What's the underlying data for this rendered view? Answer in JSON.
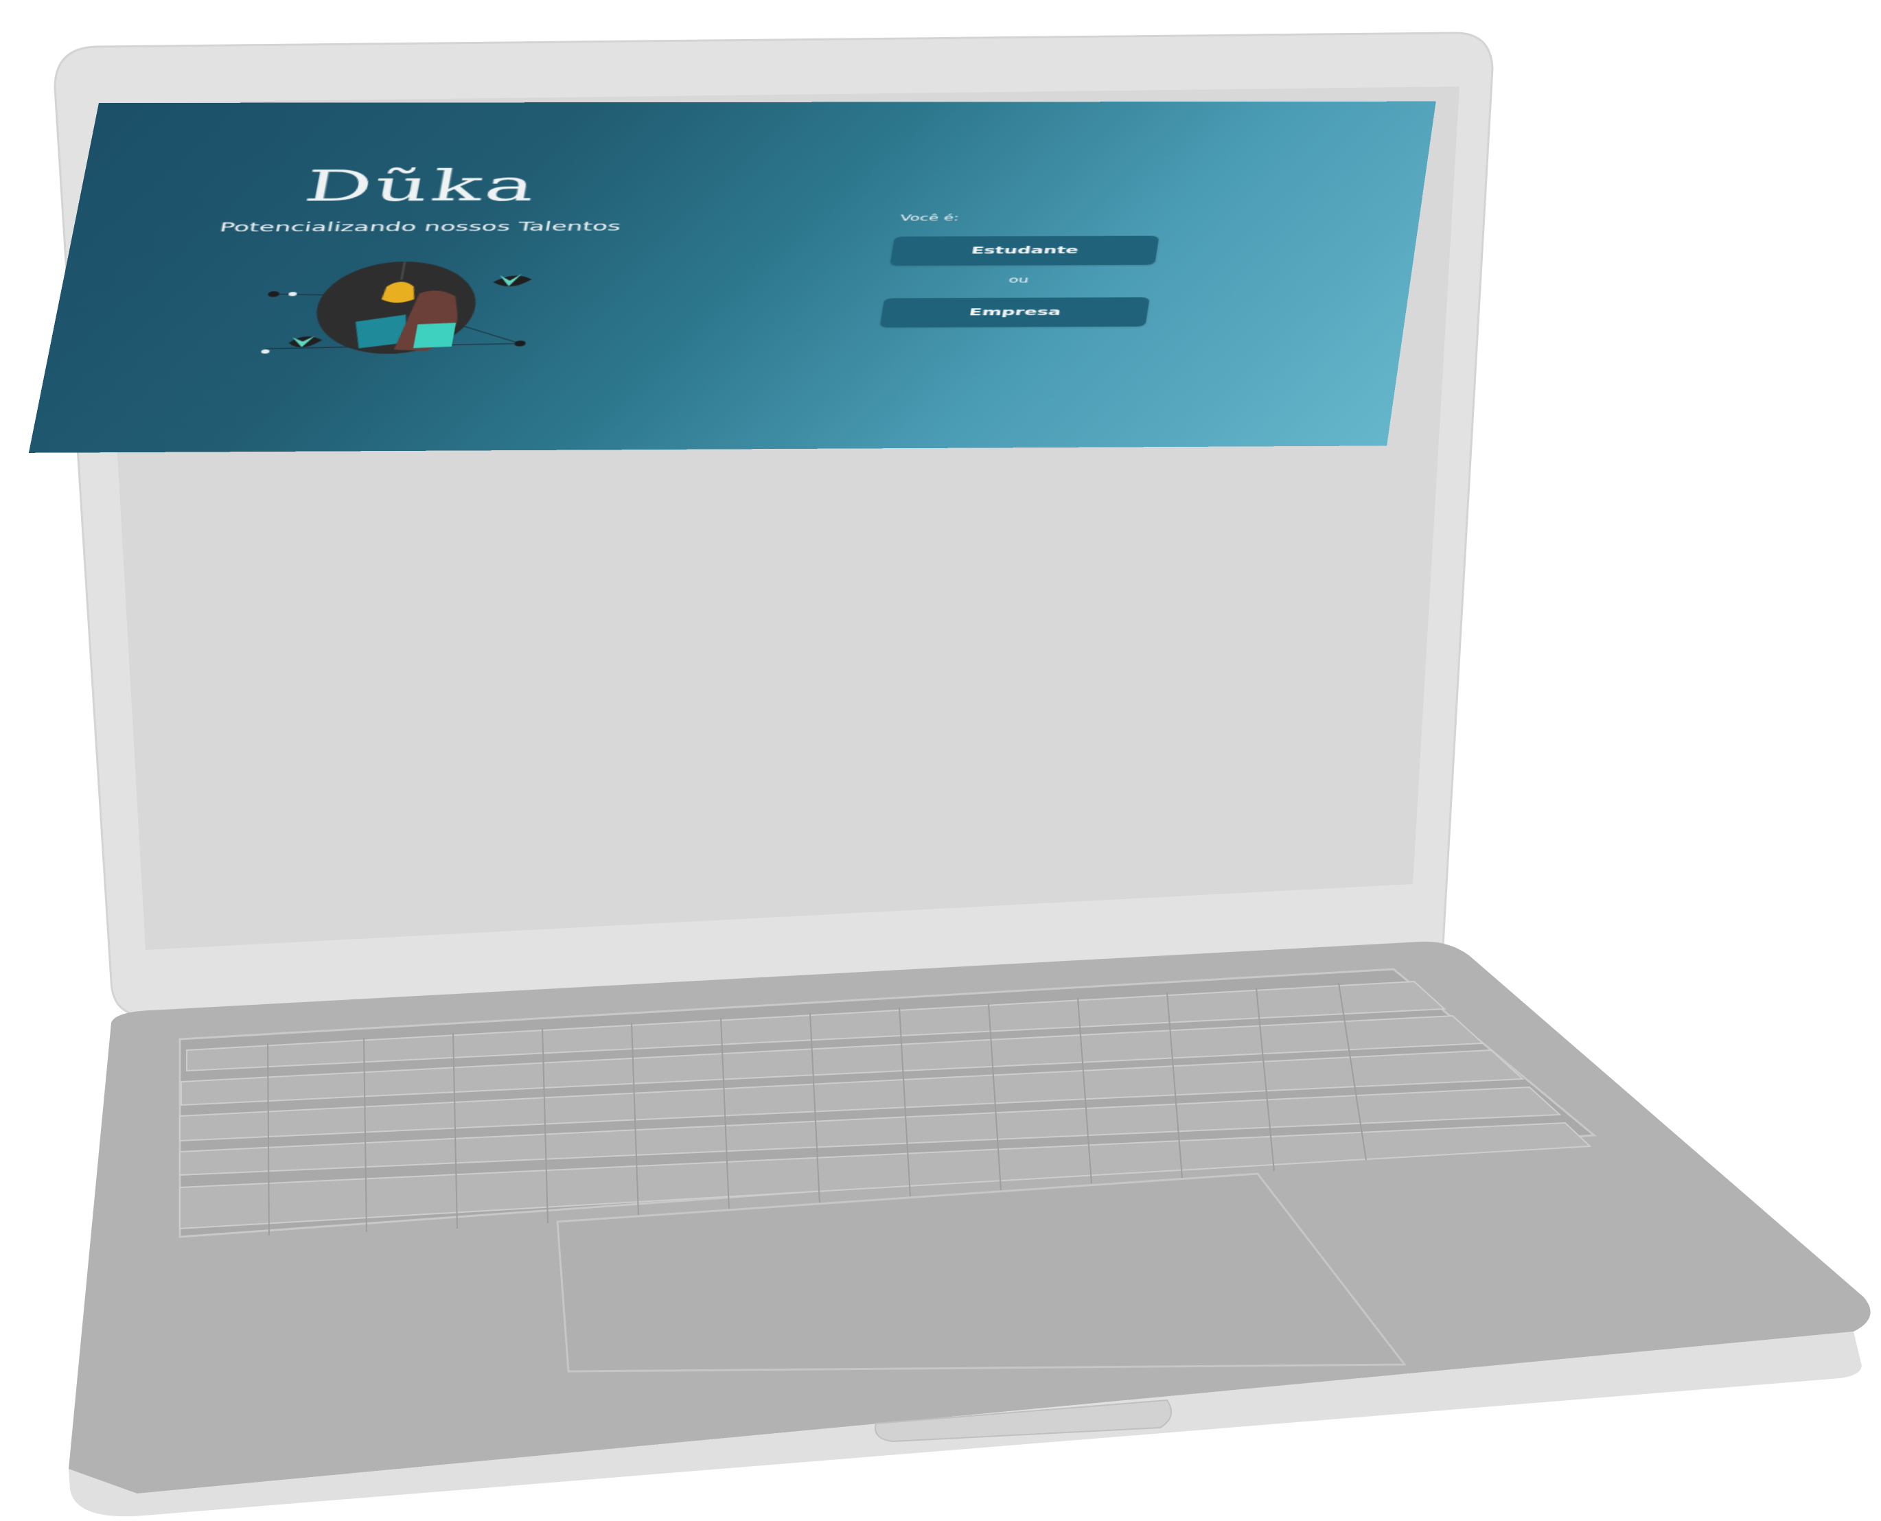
{
  "brand": {
    "logo_text": "Dũka",
    "tagline": "Potencializando nossos Talentos"
  },
  "role_select": {
    "prompt": "Você é:",
    "student_label": "Estudante",
    "separator": "ou",
    "company_label": "Empresa"
  },
  "illustration": {
    "icon": "person-reading-book-lightbulb-illustration"
  },
  "colors": {
    "background_dark": "#1b4f68",
    "background_light": "#66b6cb",
    "button": "#20627a",
    "text": "#eef2f3",
    "device_frame": "#e2e2e2",
    "keyboard_deck": "#b2b2b2"
  }
}
